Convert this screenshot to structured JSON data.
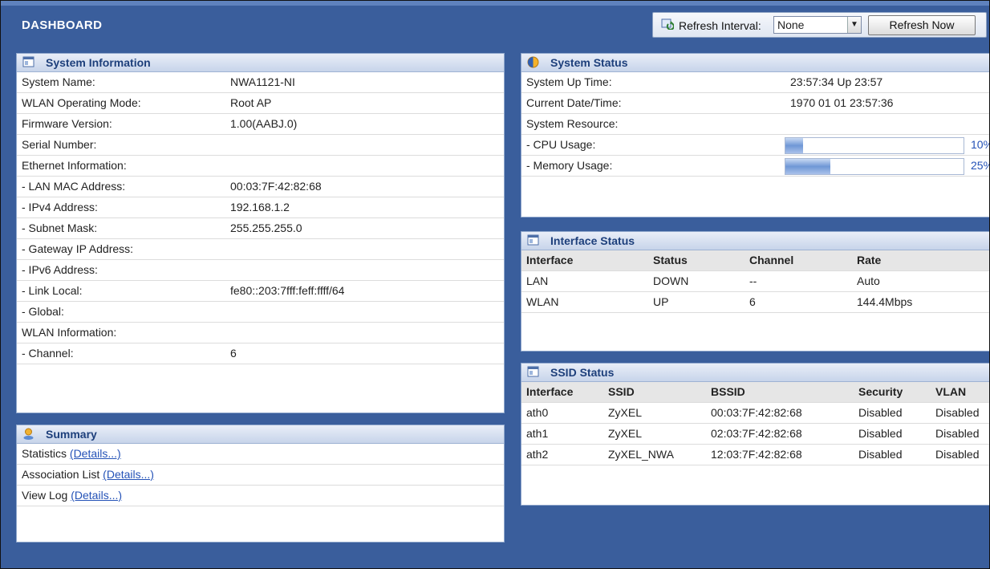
{
  "header": {
    "title": "DASHBOARD"
  },
  "refresh": {
    "label": "Refresh Interval:",
    "selected": "None",
    "button": "Refresh Now"
  },
  "system_info": {
    "title": "System Information",
    "rows": [
      {
        "label": "System Name:",
        "value": "NWA1121-NI"
      },
      {
        "label": "WLAN Operating Mode:",
        "value": "Root AP"
      },
      {
        "label": "Firmware Version:",
        "value": "1.00(AABJ.0)"
      },
      {
        "label": "Serial Number:",
        "value": ""
      },
      {
        "label": "Ethernet Information:",
        "value": ""
      },
      {
        "label": " - LAN MAC Address:",
        "value": "00:03:7F:42:82:68"
      },
      {
        "label": " - IPv4 Address:",
        "value": "192.168.1.2"
      },
      {
        "label": " - Subnet Mask:",
        "value": "255.255.255.0"
      },
      {
        "label": " - Gateway IP Address:",
        "value": ""
      },
      {
        "label": " - IPv6 Address:",
        "value": ""
      },
      {
        "label": "  - Link Local:",
        "value": "fe80::203:7fff:feff:ffff/64"
      },
      {
        "label": "  - Global:",
        "value": ""
      },
      {
        "label": "WLAN Information:",
        "value": ""
      },
      {
        "label": " - Channel:",
        "value": "6"
      }
    ]
  },
  "summary": {
    "title": "Summary",
    "rows": [
      {
        "label": "Statistics",
        "link": "(Details...)"
      },
      {
        "label": "Association List",
        "link": "(Details...)"
      },
      {
        "label": "View Log",
        "link": "(Details...)"
      }
    ]
  },
  "system_status": {
    "title": "System Status",
    "uptime_label": "System Up Time:",
    "uptime": "23:57:34 Up 23:57",
    "datetime_label": "Current Date/Time:",
    "datetime": "1970 01 01 23:57:36",
    "resource_label": "System Resource:",
    "cpu_label": "- CPU Usage:",
    "cpu_value": "10%",
    "cpu_fraction": 0.1,
    "mem_label": "- Memory Usage:",
    "mem_value": "25%",
    "mem_fraction": 0.25
  },
  "interface_status": {
    "title": "Interface Status",
    "headers": [
      "Interface",
      "Status",
      "Channel",
      "Rate"
    ],
    "rows": [
      [
        "LAN",
        "DOWN",
        "--",
        "Auto"
      ],
      [
        "WLAN",
        "UP",
        "6",
        "144.4Mbps"
      ]
    ]
  },
  "ssid_status": {
    "title": "SSID Status",
    "headers": [
      "Interface",
      "SSID",
      "BSSID",
      "Security",
      "VLAN"
    ],
    "rows": [
      [
        "ath0",
        "ZyXEL",
        "00:03:7F:42:82:68",
        "Disabled",
        "Disabled"
      ],
      [
        "ath1",
        "ZyXEL",
        "02:03:7F:42:82:68",
        "Disabled",
        "Disabled"
      ],
      [
        "ath2",
        "ZyXEL_NWA",
        "12:03:7F:42:82:68",
        "Disabled",
        "Disabled"
      ]
    ]
  },
  "colors": {
    "background": "#3a5e9c",
    "panel_header_text": "#1d3f7b",
    "link": "#2452b7",
    "bar_fill": "#6f97d6"
  },
  "icons": {
    "refresh": "refresh-icon",
    "panel": "window-icon",
    "status": "status-globe-icon",
    "summary": "user-icon"
  }
}
